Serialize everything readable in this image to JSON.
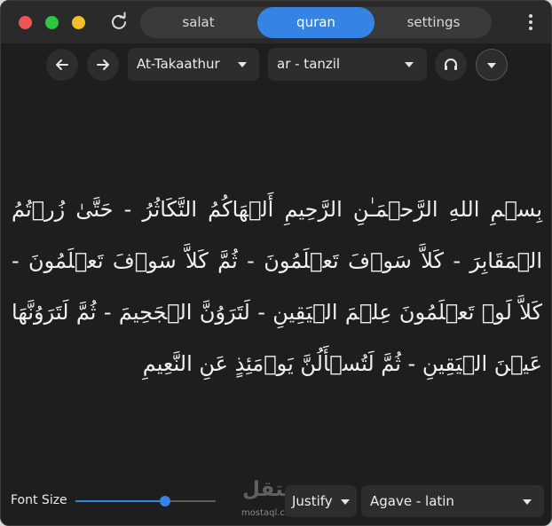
{
  "tabs": [
    {
      "label": "salat",
      "active": false
    },
    {
      "label": "quran",
      "active": true
    },
    {
      "label": "settings",
      "active": false
    }
  ],
  "toolbar": {
    "surah": "At-Takaathur",
    "translation": "ar - tanzil"
  },
  "quran_text": "بِسۡمِ اللهِ الرَّحۡمَـٰنِ الرَّحِيمِ أَلۡهَاكُمُ التَّكَاثُرُ - حَتَّىٰ زُرۡتُمُ الۡمَقَابِرَ - كَلاَّ سَوۡفَ تَعۡلَمُونَ - ثُمَّ كَلاَّ سَوۡفَ تَعۡلَمُونَ - كَلاَّ لَوۡ تَعۡلَمُونَ عِلۡمَ الۡيَقِينِ - لَتَرَوُنَّ الۡجَحِيمَ - ثُمَّ لَتَرَوُنَّهَا عَيۡنَ الۡيَقِينِ - ثُمَّ لَتُسۡأَلُنَّ يَوۡمَئِذٍ عَنِ النَّعِيمِ",
  "bottom": {
    "font_size_label": "Font Size",
    "font_size_level": 0.64,
    "alignment": "Justify",
    "font": "Agave - latin"
  },
  "watermark": {
    "arabic": "مستقل",
    "latin": "mostaql.com"
  },
  "colors": {
    "accent": "#3584e4",
    "window_bg": "#1e1e1e",
    "close": "#ee5552",
    "maximize": "#2bc840",
    "minimize": "#f5be27"
  }
}
